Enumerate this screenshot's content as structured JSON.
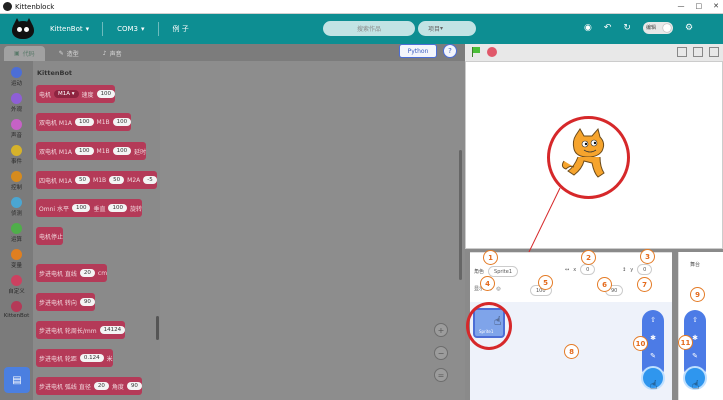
{
  "window": {
    "title": "Kittenblock",
    "controls": [
      "—",
      "□",
      "✕"
    ]
  },
  "menubar": {
    "items": [
      {
        "label": "KittenBot",
        "caret": "▾"
      },
      {
        "label": "COM3",
        "caret": "▾"
      },
      {
        "label": "例 子",
        "caret": ""
      }
    ],
    "search_placeholder": "搜索作品",
    "project_title": "项目",
    "project_caret": "▾",
    "toggle_label": "编辑",
    "icons": [
      "camera-icon",
      "undo-icon",
      "redo-icon",
      "toggle",
      "gear-icon"
    ]
  },
  "tabs": [
    {
      "icon": "▣",
      "label": "代码",
      "active": true
    },
    {
      "icon": "✎",
      "label": "造型",
      "active": false
    },
    {
      "icon": "♪",
      "label": "声音",
      "active": false
    }
  ],
  "buttons": {
    "python": "Python",
    "help": "?"
  },
  "categories": [
    {
      "label": "运动",
      "color": "#4c6ed6"
    },
    {
      "label": "外观",
      "color": "#8e5fd6"
    },
    {
      "label": "声音",
      "color": "#c662c6"
    },
    {
      "label": "事件",
      "color": "#d6b22a"
    },
    {
      "label": "控制",
      "color": "#d68b1e"
    },
    {
      "label": "侦测",
      "color": "#4ba6d2"
    },
    {
      "label": "运算",
      "color": "#4fae4a"
    },
    {
      "label": "变量",
      "color": "#e07f20"
    },
    {
      "label": "自定义",
      "color": "#cc4160"
    },
    {
      "label": "KittenBot",
      "color": "#b43a58"
    }
  ],
  "palette": {
    "heading": "KittenBot",
    "blocks": [
      {
        "parts": [
          {
            "t": "text",
            "v": "电机"
          },
          {
            "t": "dd",
            "v": "M1A ▾"
          },
          {
            "t": "text",
            "v": "速度"
          },
          {
            "t": "pill",
            "v": "100"
          }
        ]
      },
      {
        "parts": [
          {
            "t": "text",
            "v": "双电机 M1A"
          },
          {
            "t": "pill",
            "v": "100"
          },
          {
            "t": "text",
            "v": "M1B"
          },
          {
            "t": "pill",
            "v": "100"
          }
        ]
      },
      {
        "parts": [
          {
            "t": "text",
            "v": "双电机 M1A"
          },
          {
            "t": "pill",
            "v": "100"
          },
          {
            "t": "text",
            "v": "M1B"
          },
          {
            "t": "pill",
            "v": "100"
          },
          {
            "t": "text",
            "v": "延时"
          }
        ]
      },
      {
        "parts": [
          {
            "t": "text",
            "v": "四电机 M1A"
          },
          {
            "t": "pill",
            "v": "50"
          },
          {
            "t": "text",
            "v": "M1B"
          },
          {
            "t": "pill",
            "v": "50"
          },
          {
            "t": "text",
            "v": "M2A"
          },
          {
            "t": "pill",
            "v": "-5"
          }
        ]
      },
      {
        "parts": [
          {
            "t": "text",
            "v": "Omni 水平"
          },
          {
            "t": "pill",
            "v": "100"
          },
          {
            "t": "text",
            "v": "垂直"
          },
          {
            "t": "pill",
            "v": "100"
          },
          {
            "t": "text",
            "v": "旋转"
          }
        ]
      },
      {
        "parts": [
          {
            "t": "text",
            "v": "电机停止"
          }
        ]
      },
      {
        "parts": [
          {
            "t": "text",
            "v": "步进电机 直线"
          },
          {
            "t": "pill",
            "v": "20"
          },
          {
            "t": "text",
            "v": "cm"
          }
        ]
      },
      {
        "parts": [
          {
            "t": "text",
            "v": "步进电机 转向"
          },
          {
            "t": "pill",
            "v": "90"
          }
        ]
      },
      {
        "parts": [
          {
            "t": "text",
            "v": "步进电机 轮周长/mm"
          },
          {
            "t": "pill",
            "v": "14124"
          }
        ]
      },
      {
        "parts": [
          {
            "t": "text",
            "v": "步进电机 轮距"
          },
          {
            "t": "pill",
            "v": "0.124"
          },
          {
            "t": "text",
            "v": "米"
          }
        ]
      },
      {
        "parts": [
          {
            "t": "text",
            "v": "步进电机 弧线 直径"
          },
          {
            "t": "pill",
            "v": "20"
          },
          {
            "t": "text",
            "v": "角度"
          },
          {
            "t": "pill",
            "v": "90"
          }
        ]
      }
    ]
  },
  "zoom": {
    "in": "+",
    "out": "−",
    "reset": "="
  },
  "sprite_info": {
    "sprite_label": "角色",
    "sprite_name": "Sprite1",
    "x_label": "x",
    "x_value": "0",
    "y_label": "y",
    "y_value": "0",
    "show_label": "显示",
    "size_value": "100",
    "direction_value": "90"
  },
  "sprite_list": [
    {
      "name": "Sprite1"
    }
  ],
  "stage_panel": {
    "label": "舞台"
  },
  "annotations": [
    "1",
    "2",
    "3",
    "4",
    "5",
    "6",
    "7",
    "8",
    "9",
    "10",
    "11"
  ]
}
